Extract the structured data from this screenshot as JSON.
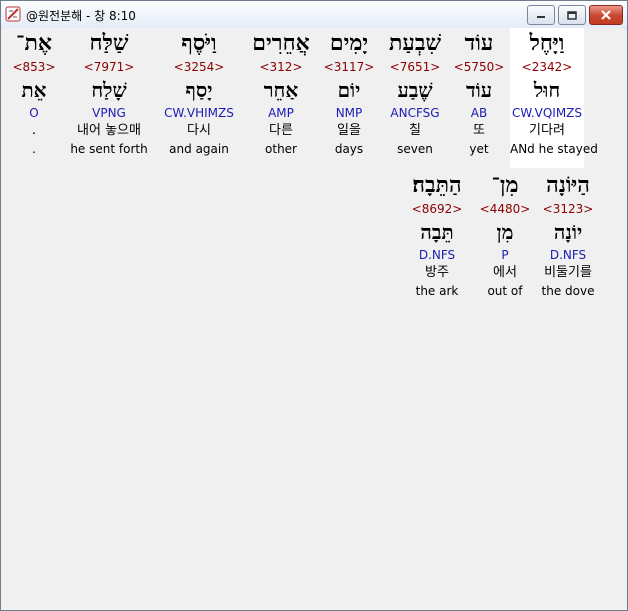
{
  "window": {
    "title": "@원전분해 - 창 8:10",
    "min_label": "—",
    "max_label": "□",
    "close_label": "✕"
  },
  "words": [
    {
      "heb": "וַיָּחֶל",
      "strong": "<2342>",
      "lemma": "חוּל",
      "parse": "CW.VQIMZS",
      "kor": "기다려",
      "eng": "ANd he stayed"
    },
    {
      "heb": "עוֹד",
      "strong": "<5750>",
      "lemma": "עוֹד",
      "parse": "AB",
      "kor": "또",
      "eng": "yet"
    },
    {
      "heb": "שִׁבְעַת",
      "strong": "<7651>",
      "lemma": "שֶׁבַע",
      "parse": "ANCFSG",
      "kor": "칠",
      "eng": "seven"
    },
    {
      "heb": "יָמִים",
      "strong": "<3117>",
      "lemma": "יוֹם",
      "parse": "NMP",
      "kor": "일을",
      "eng": "days"
    },
    {
      "heb": "אֲחֵרִים",
      "strong": "<312>",
      "lemma": "אַחֵר",
      "parse": "AMP",
      "kor": "다른",
      "eng": "other"
    },
    {
      "heb": "וַיֹּסֶף",
      "strong": "<3254>",
      "lemma": "יָסַף",
      "parse": "CW.VHIMZS",
      "kor": "다시",
      "eng": "and again"
    },
    {
      "heb": "שַׁלַּח",
      "strong": "<7971>",
      "lemma": "שָׁלַח",
      "parse": "VPNG",
      "kor": "내어 놓으매",
      "eng": "he sent forth"
    },
    {
      "heb": "אֶת־",
      "strong": "<853>",
      "lemma": "אֵת",
      "parse": "O",
      "kor": ".",
      "eng": "."
    },
    {
      "heb": "הַיּוֹנָה",
      "strong": "<3123>",
      "lemma": "יוֹנָה",
      "parse": "D.NFS",
      "kor": "비둘기를",
      "eng": "the dove"
    },
    {
      "heb": "מִן־",
      "strong": "<4480>",
      "lemma": "מִן",
      "parse": "P",
      "kor": "에서",
      "eng": "out of"
    },
    {
      "heb": "הַתֵּבָה׃",
      "strong": "<8692>",
      "lemma": "תֵּבָה",
      "parse": "D.NFS",
      "kor": "방주",
      "eng": "the ark"
    }
  ]
}
